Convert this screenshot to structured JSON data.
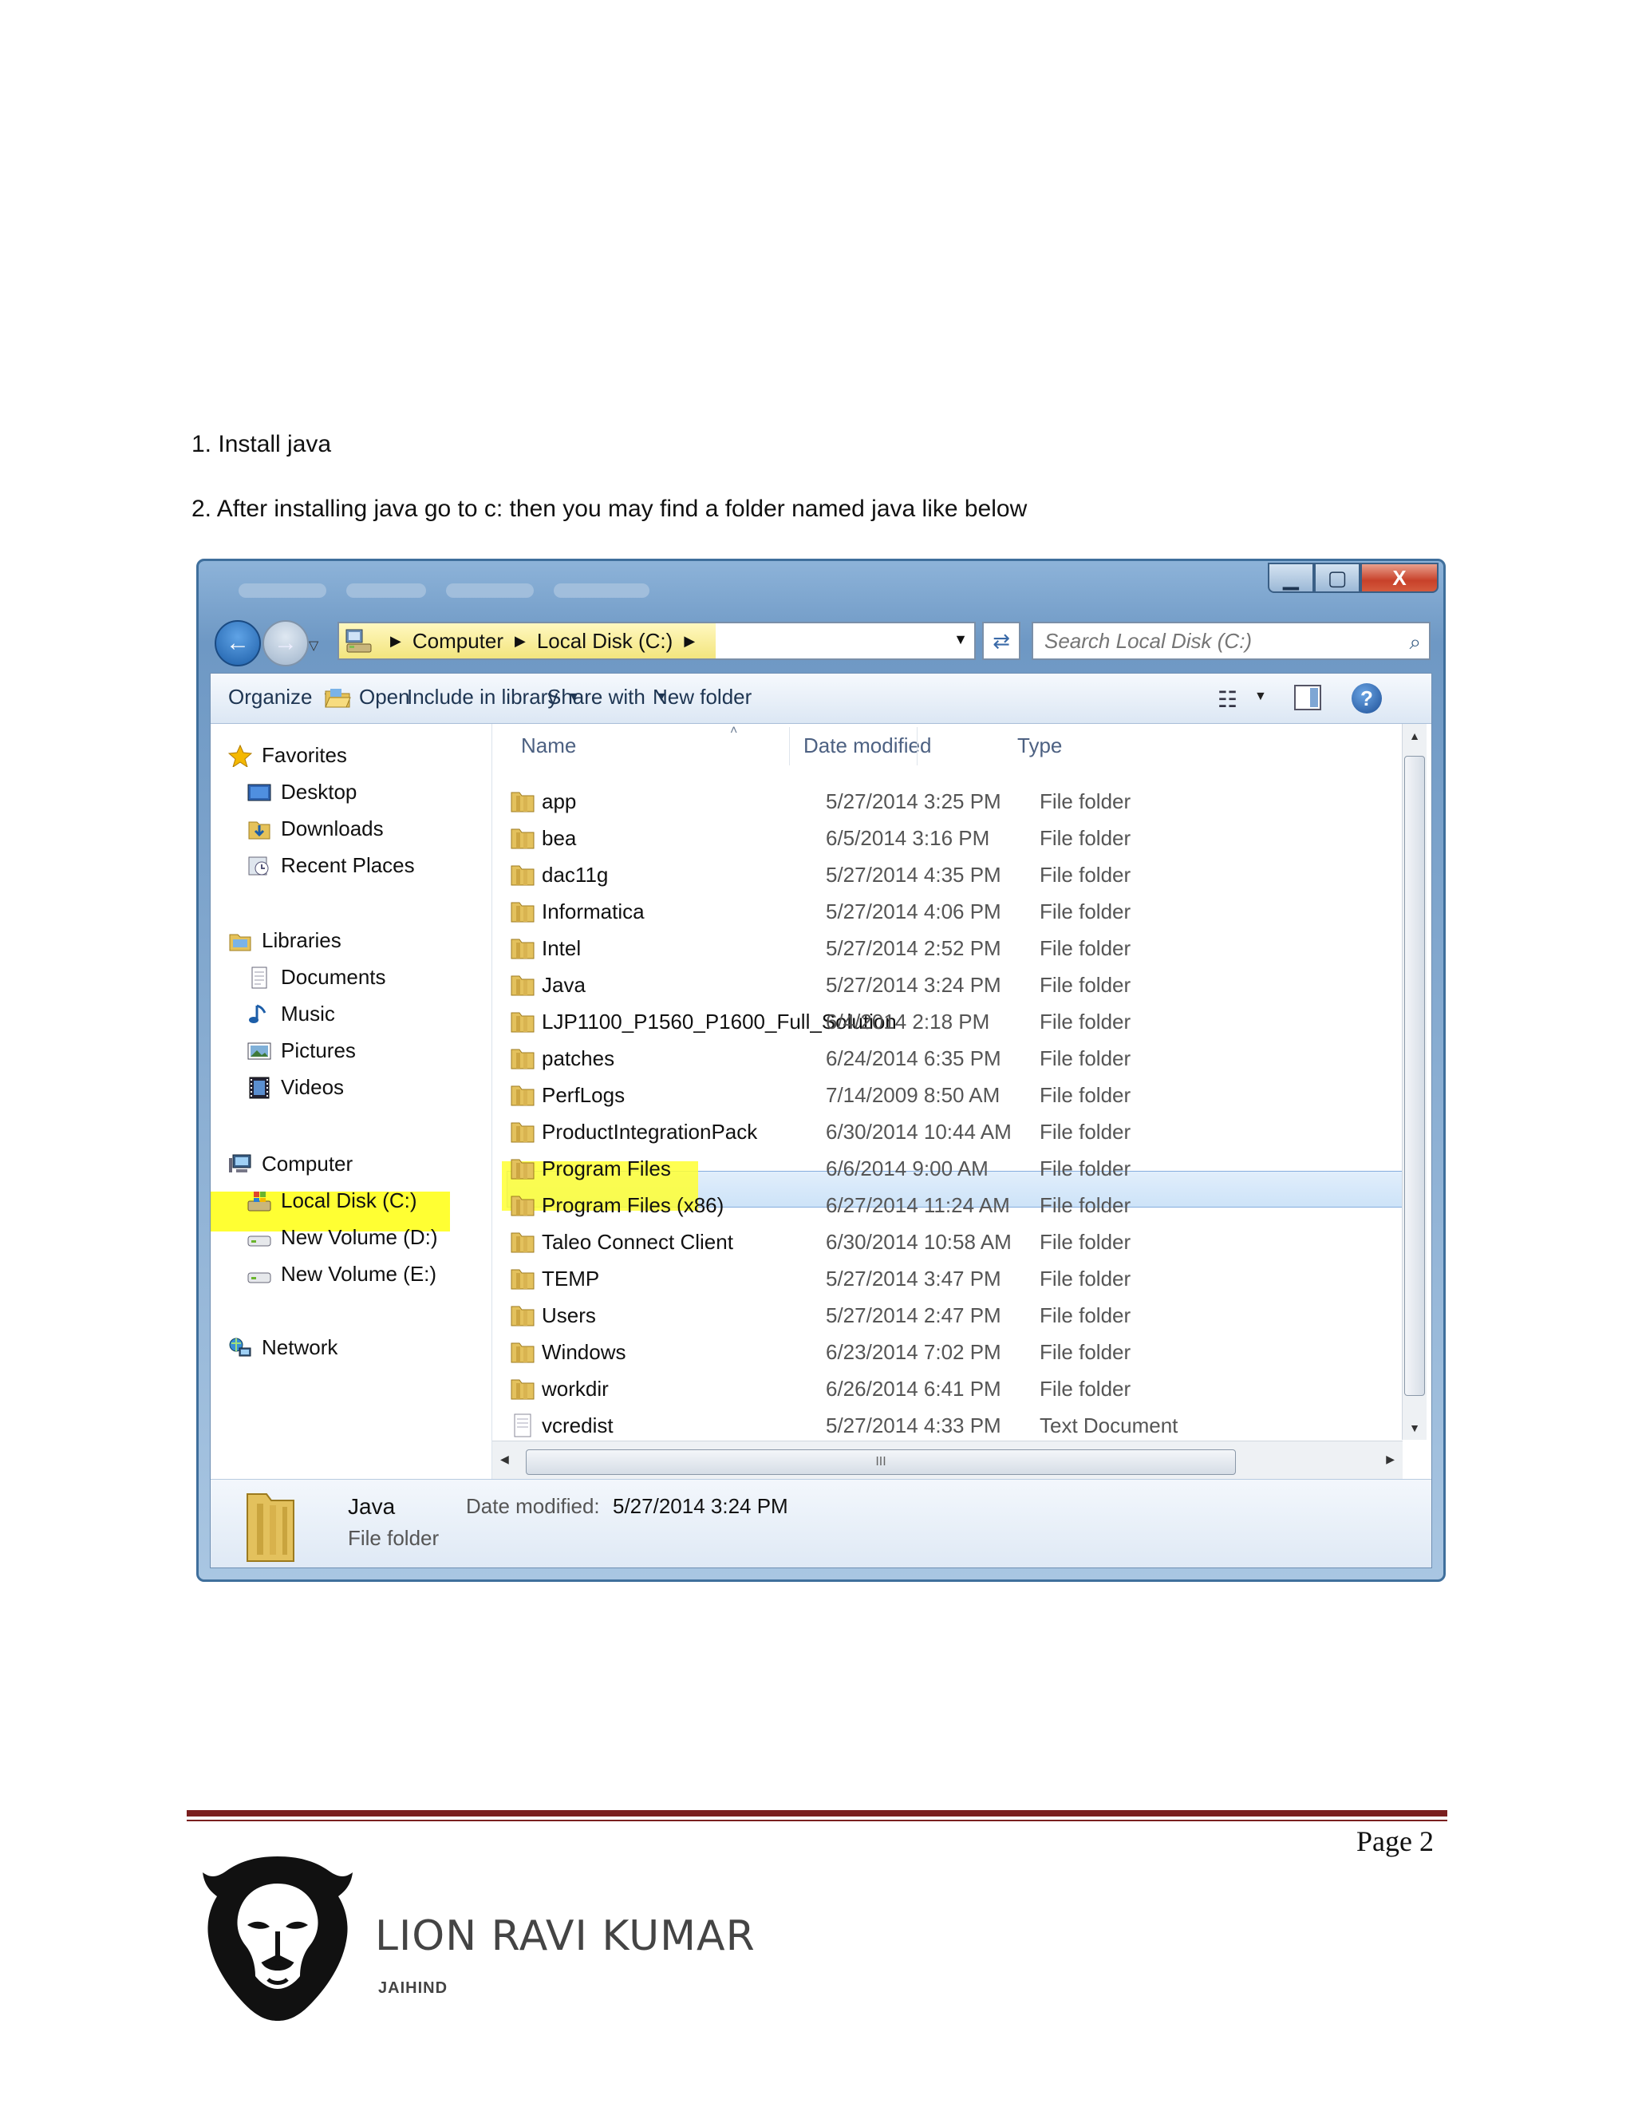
{
  "steps": {
    "step1": "1. Install java",
    "step2": "2. After installing java go to c: then you may find a folder named java like below"
  },
  "window": {
    "caption_buttons": {
      "minimize": "▁",
      "maximize": "▢",
      "close": "X"
    },
    "address": {
      "crumbs": [
        "Computer",
        "Local Disk (C:)"
      ],
      "search_placeholder": "Search Local Disk (C:)"
    },
    "toolbar": {
      "organize": "Organize",
      "open": "Open",
      "include_in_library": "Include in library",
      "share_with": "Share with",
      "new_folder": "New folder"
    },
    "nav": {
      "favorites": "Favorites",
      "desktop": "Desktop",
      "downloads": "Downloads",
      "recent_places": "Recent Places",
      "libraries": "Libraries",
      "documents": "Documents",
      "music": "Music",
      "pictures": "Pictures",
      "videos": "Videos",
      "computer": "Computer",
      "local_disk": "Local Disk (C:)",
      "new_volume_d": "New Volume (D:)",
      "new_volume_e": "New Volume (E:)",
      "network": "Network"
    },
    "columns": {
      "name": "Name",
      "date_modified": "Date modified",
      "type": "Type"
    },
    "files": [
      {
        "name": "app",
        "date": "5/27/2014 3:25 PM",
        "type": "File folder"
      },
      {
        "name": "bea",
        "date": "6/5/2014 3:16 PM",
        "type": "File folder"
      },
      {
        "name": "dac11g",
        "date": "5/27/2014 4:35 PM",
        "type": "File folder"
      },
      {
        "name": "Informatica",
        "date": "5/27/2014 4:06 PM",
        "type": "File folder"
      },
      {
        "name": "Intel",
        "date": "5/27/2014 2:52 PM",
        "type": "File folder"
      },
      {
        "name": "Java",
        "date": "5/27/2014 3:24 PM",
        "type": "File folder"
      },
      {
        "name": "LJP1100_P1560_P1600_Full_Solution",
        "date": "6/4/2014 2:18 PM",
        "type": "File folder"
      },
      {
        "name": "patches",
        "date": "6/24/2014 6:35 PM",
        "type": "File folder"
      },
      {
        "name": "PerfLogs",
        "date": "7/14/2009 8:50 AM",
        "type": "File folder"
      },
      {
        "name": "ProductIntegrationPack",
        "date": "6/30/2014 10:44 AM",
        "type": "File folder"
      },
      {
        "name": "Program Files",
        "date": "6/6/2014 9:00 AM",
        "type": "File folder"
      },
      {
        "name": "Program Files (x86)",
        "date": "6/27/2014 11:24 AM",
        "type": "File folder"
      },
      {
        "name": "Taleo Connect Client",
        "date": "6/30/2014 10:58 AM",
        "type": "File folder"
      },
      {
        "name": "TEMP",
        "date": "5/27/2014 3:47 PM",
        "type": "File folder"
      },
      {
        "name": "Users",
        "date": "5/27/2014 2:47 PM",
        "type": "File folder"
      },
      {
        "name": "Windows",
        "date": "6/23/2014 7:02 PM",
        "type": "File folder"
      },
      {
        "name": "workdir",
        "date": "6/26/2014 6:41 PM",
        "type": "File folder"
      },
      {
        "name": "vcredist",
        "date": "5/27/2014 4:33 PM",
        "type": "Text Document"
      }
    ],
    "details": {
      "name": "Java",
      "type": "File folder",
      "date_label": "Date modified:",
      "date_value": "5/27/2014 3:24 PM"
    },
    "hscroll_grip": "III",
    "highlight_color": "#ffff33",
    "selection_color": "#cde3f8"
  },
  "footer": {
    "page": "Page 2",
    "brand_name": "LION RAVI KUMAR",
    "brand_sub": "JAIHIND",
    "rule_color": "#7a1f1f"
  }
}
